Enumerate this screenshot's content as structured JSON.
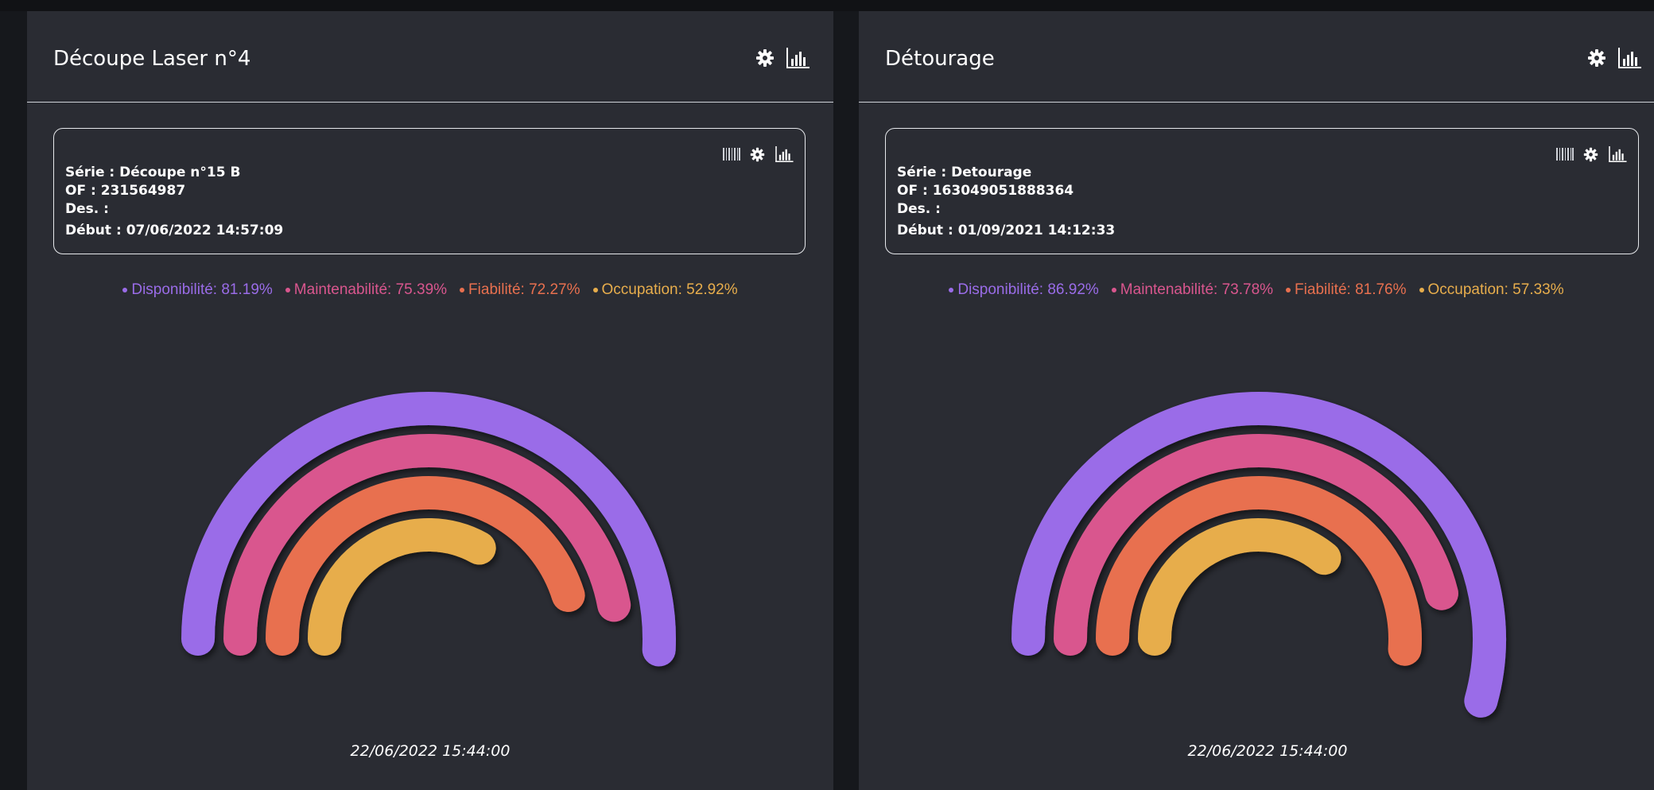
{
  "colors": {
    "disponibilite": "#9a6ce8",
    "maintenabilite": "#d9568e",
    "fiabilite": "#e8704f",
    "occupation": "#e7ad4c",
    "panel_bg": "#2a2c33",
    "page_bg": "#16181c"
  },
  "icons": {
    "header": [
      "gear-icon",
      "bar-chart-icon"
    ],
    "box": [
      "barcode-icon",
      "gear-icon",
      "bar-chart-icon"
    ]
  },
  "panels": [
    {
      "title": "Découpe Laser n°4",
      "info": {
        "serie_label": "Série :",
        "serie_value": "Découpe n°15 B",
        "of_label": "OF :",
        "of_value": "231564987",
        "des_label": "Des. :",
        "des_value": "",
        "debut_label": "Début :",
        "debut_value": "07/06/2022 14:57:09"
      },
      "legend": [
        {
          "label": "Disponibilité: 81.19%",
          "color": "#9a6ce8"
        },
        {
          "label": "Maintenabilité: 75.39%",
          "color": "#d9568e"
        },
        {
          "label": "Fiabilité: 72.27%",
          "color": "#e8704f"
        },
        {
          "label": "Occupation: 52.92%",
          "color": "#e7ad4c"
        }
      ],
      "values": [
        81.19,
        75.39,
        72.27,
        52.92
      ],
      "timestamp": "22/06/2022 15:44:00"
    },
    {
      "title": "Détourage",
      "info": {
        "serie_label": "Série :",
        "serie_value": "Detourage",
        "of_label": "OF :",
        "of_value": "163049051888364",
        "des_label": "Des. :",
        "des_value": "",
        "debut_label": "Début :",
        "debut_value": "01/09/2021 14:12:33"
      },
      "legend": [
        {
          "label": "Disponibilité: 86.92%",
          "color": "#9a6ce8"
        },
        {
          "label": "Maintenabilité: 73.78%",
          "color": "#d9568e"
        },
        {
          "label": "Fiabilité: 81.76%",
          "color": "#e8704f"
        },
        {
          "label": "Occupation: 57.33%",
          "color": "#e7ad4c"
        }
      ],
      "values": [
        86.92,
        73.78,
        81.76,
        57.33
      ],
      "timestamp": "22/06/2022 15:44:00"
    }
  ]
}
